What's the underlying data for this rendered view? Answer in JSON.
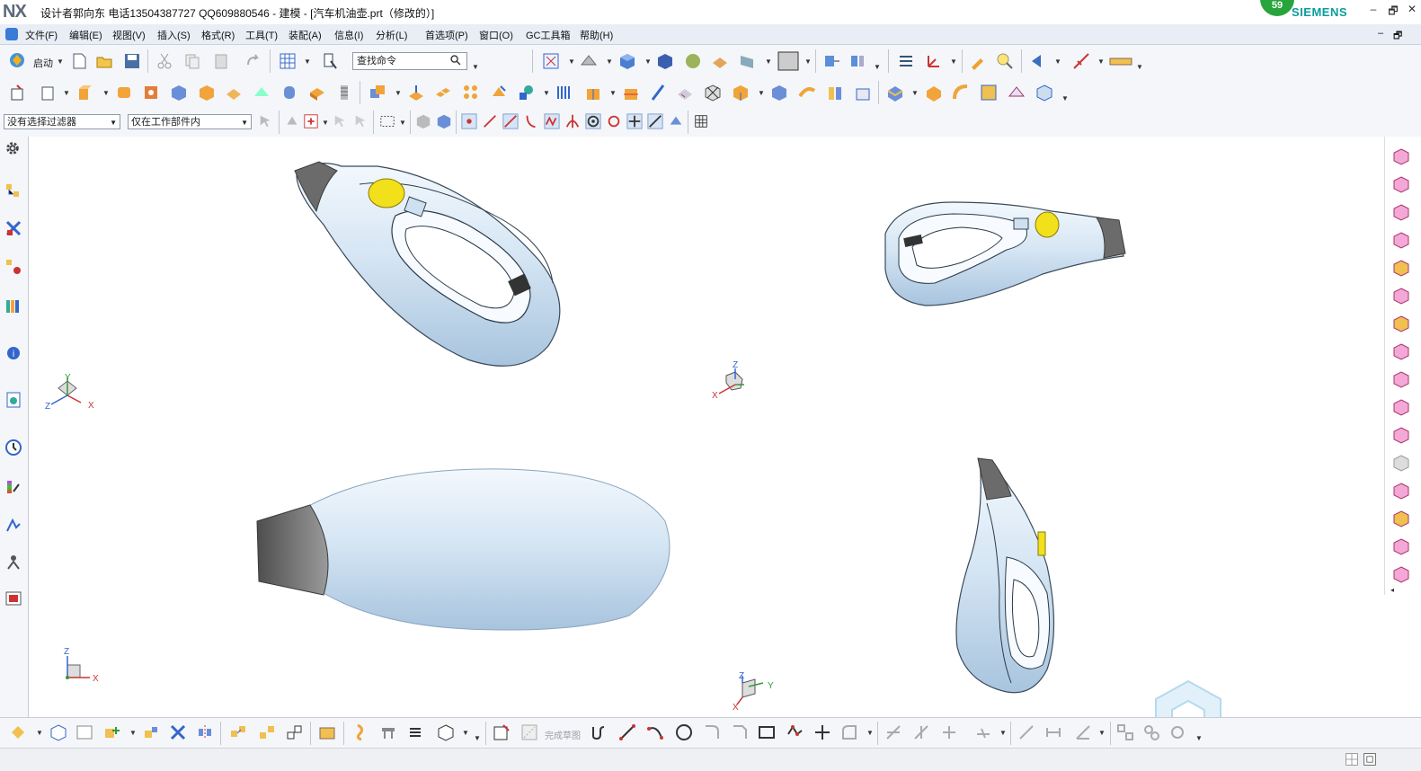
{
  "titlebar": {
    "logo": "NX",
    "title": "设计者郭向东  电话13504387727  QQ609880546 - 建模 - [汽车机油壶.prt（修改的）]",
    "badge": "59",
    "brand": "SIEMENS",
    "win_controls": [
      "–",
      "🗗",
      "✕"
    ]
  },
  "menubar": {
    "items": [
      "文件(F)",
      "编辑(E)",
      "视图(V)",
      "插入(S)",
      "格式(R)",
      "工具(T)",
      "装配(A)",
      "信息(I)",
      "分析(L)",
      "首选项(P)",
      "窗口(O)",
      "GC工具箱",
      "帮助(H)"
    ],
    "doc_controls": [
      "–",
      "🗗"
    ]
  },
  "toolbar1": {
    "start_label": "启动",
    "search_placeholder": "查找命令"
  },
  "toolbar3": {
    "filter_select": "没有选择过滤器",
    "scope_select": "仅在工作部件内"
  },
  "bottom_toolbar": {
    "finish_sketch": "完成草图"
  },
  "axes": {
    "x": "X",
    "y": "Y",
    "z": "Z"
  },
  "colors": {
    "body": "#cfe1f2",
    "body_shade": "#8fb3d3",
    "nozzle": "#6f6f6f",
    "cap": "#f2e01a",
    "accent": "#3a7bd5"
  }
}
